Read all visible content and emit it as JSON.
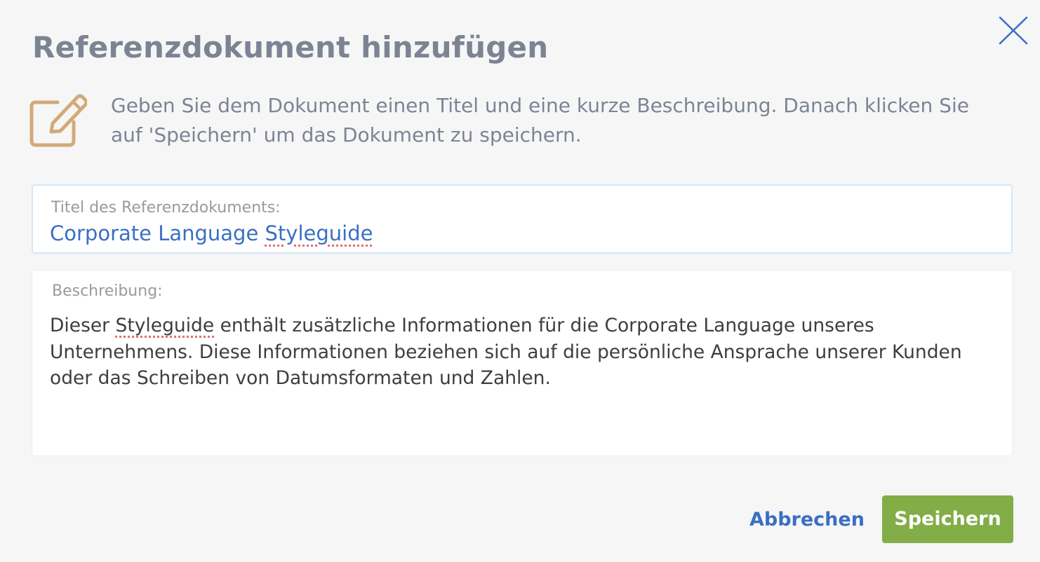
{
  "dialog": {
    "title": "Referenzdokument hinzufügen",
    "info_text": "Geben Sie dem Dokument einen Titel und eine kurze Beschreibung. Danach klicken Sie auf 'Speichern' um das Dokument zu speichern.",
    "info_icon": "edit-icon",
    "close_icon": "close-icon"
  },
  "form": {
    "title_field": {
      "label": "Titel des Referenzdokuments:",
      "value_prefix": "Corporate Language ",
      "value_misspelled": "Styleguide"
    },
    "description_field": {
      "label": "Beschreibung:",
      "value_prefix": "Dieser ",
      "value_misspelled": "Styleguide",
      "value_suffix": " enthält zusätzliche Informationen für die Corporate Language unseres Unternehmens. Diese Informationen beziehen sich auf die persönliche Ansprache unserer Kunden oder das Schreiben von Datumsformaten und Zahlen."
    }
  },
  "actions": {
    "cancel_label": "Abbrechen",
    "save_label": "Speichern"
  },
  "colors": {
    "title_text": "#7c8494",
    "accent_blue": "#3a6fc2",
    "save_green": "#82ad47",
    "icon_tan": "#d2aa78",
    "spellcheck_red": "#e07070"
  }
}
